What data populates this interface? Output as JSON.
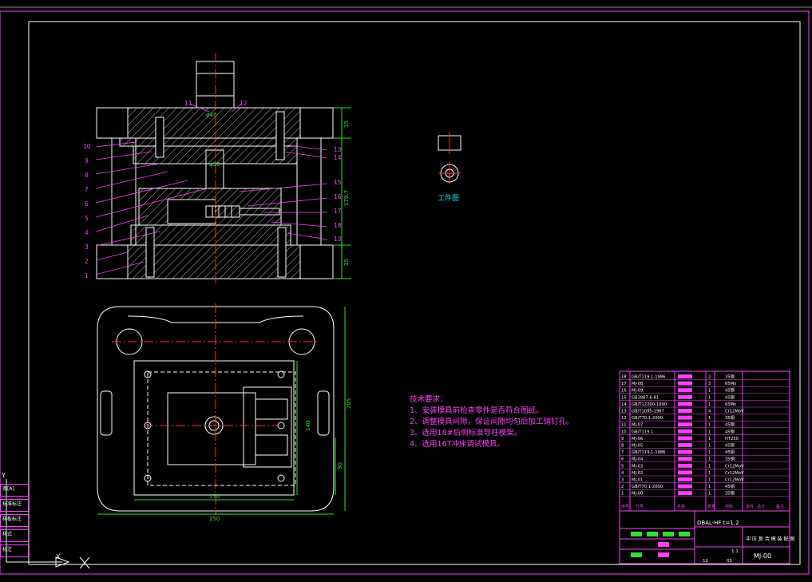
{
  "drawing": {
    "tech_requirements": {
      "title": "技术要求：",
      "items": [
        "1、安装模具前检查零件是否符合图纸。",
        "2、调整模具间隙，保证间隙均匀后加工销钉孔。",
        "3、选用18#后侧标准导柱模架。",
        "4、选用16T冲床调试模具。"
      ]
    },
    "workpiece_label": "工件图",
    "part_labels_left": [
      "10",
      "9",
      "8",
      "7",
      "6",
      "5",
      "4",
      "3",
      "2",
      "1"
    ],
    "part_labels_right_top": [
      "11",
      "12"
    ],
    "part_labels_right": [
      "13",
      "14",
      "15",
      "16",
      "17",
      "18",
      "13"
    ],
    "dimensions": {
      "height_total": "179.7",
      "top_plate": "35",
      "bottom_plate": "35",
      "width_outer": "250",
      "width_inner": "170",
      "depth_outer": "205",
      "depth_inner": "140",
      "depth_small": "90",
      "punch_dia": "φ40",
      "punch_shank": "φ30"
    },
    "title_block": {
      "drawing_name": "DBAL-HF  t=1.2",
      "product_name": "冲 压 复 合 模 装 配 图",
      "drawing_no": "MJ-00",
      "scale": "1:1",
      "sheet_a": "12",
      "sheet_b": "01"
    },
    "bom": [
      {
        "no": "18",
        "code": "GB/T119.1-1986",
        "qty": "2",
        "mat": "35钢"
      },
      {
        "no": "17",
        "code": "MJ-08",
        "qty": "3",
        "mat": "65Mn"
      },
      {
        "no": "16",
        "code": "MJ-09",
        "qty": "1",
        "mat": "45钢"
      },
      {
        "no": "15",
        "code": "GB2867.6-81",
        "qty": "1",
        "mat": "45钢"
      },
      {
        "no": "14",
        "code": "GB/T12200-1990",
        "qty": "1",
        "mat": "65Mn"
      },
      {
        "no": "13",
        "code": "GB/T1095-1987",
        "qty": "4",
        "mat": "Cr12MoV"
      },
      {
        "no": "12",
        "code": "GB/T70.1-2000",
        "qty": "1",
        "mat": "35钢"
      },
      {
        "no": "11",
        "code": "MJ-07",
        "qty": "1",
        "mat": "45钢"
      },
      {
        "no": "10",
        "code": "GB/T119.1",
        "qty": "1",
        "mat": "45钢"
      },
      {
        "no": "9",
        "code": "MJ-06",
        "qty": "1",
        "mat": "HT250"
      },
      {
        "no": "8",
        "code": "MJ-05",
        "qty": "1",
        "mat": "45钢"
      },
      {
        "no": "7",
        "code": "GB/T119.1-1986",
        "qty": "1",
        "mat": "45钢"
      },
      {
        "no": "6",
        "code": "MJ-04",
        "qty": "1",
        "mat": "35钢"
      },
      {
        "no": "5",
        "code": "MJ-03",
        "qty": "1",
        "mat": "Cr12MoV"
      },
      {
        "no": "4",
        "code": "MJ-02",
        "qty": "1",
        "mat": "Cr12MoV"
      },
      {
        "no": "3",
        "code": "MJ-01",
        "qty": "1",
        "mat": "Cr12MoV"
      },
      {
        "no": "2",
        "code": "GB/T70.1-2000",
        "qty": "1",
        "mat": "45钢"
      },
      {
        "no": "1",
        "code": "MJ-00",
        "qty": "1",
        "mat": "35钢"
      }
    ],
    "bom_header": [
      "序号",
      "代号",
      "名称",
      "数量",
      "材料",
      "单件",
      "总计",
      "备注"
    ]
  },
  "side_panel": {
    "items": [
      "宽[A]",
      "标准标注",
      "样板标注",
      "样式",
      "标注"
    ]
  },
  "ucs": {
    "x_label": "X",
    "y_label": "Y"
  }
}
